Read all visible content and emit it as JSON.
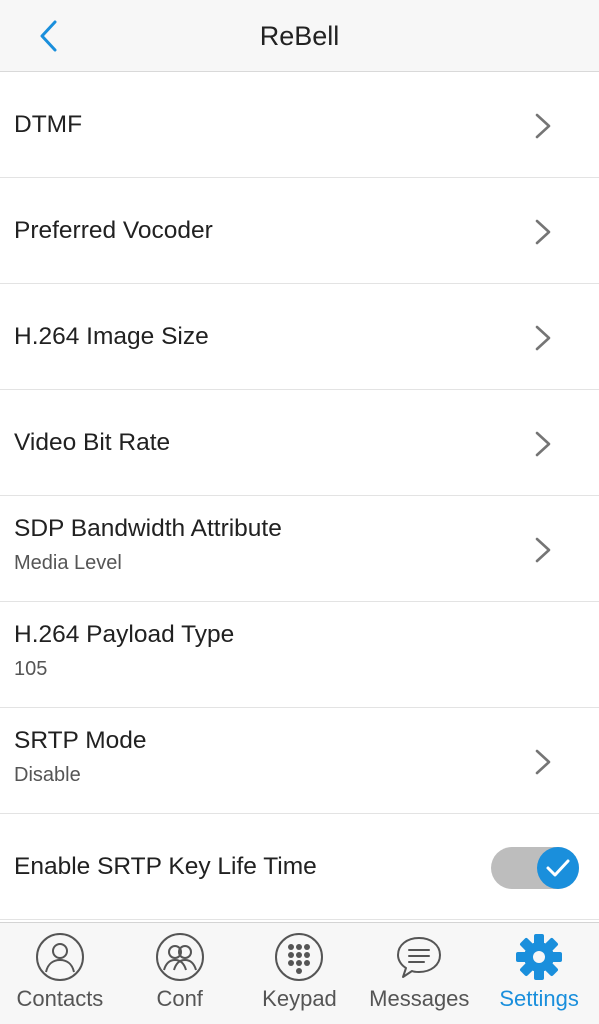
{
  "header": {
    "title": "ReBell",
    "back_icon": "chevron-left-icon"
  },
  "settings": [
    {
      "label": "DTMF",
      "value": "",
      "has_chevron": true
    },
    {
      "label": "Preferred Vocoder",
      "value": "",
      "has_chevron": true
    },
    {
      "label": "H.264 Image Size",
      "value": "",
      "has_chevron": true
    },
    {
      "label": "Video Bit Rate",
      "value": "",
      "has_chevron": true
    },
    {
      "label": "SDP Bandwidth Attribute",
      "value": "Media Level",
      "has_chevron": true
    },
    {
      "label": "H.264 Payload Type",
      "value": "105",
      "has_chevron": false
    },
    {
      "label": "SRTP Mode",
      "value": "Disable",
      "has_chevron": true
    },
    {
      "label": "Enable SRTP Key Life Time",
      "value": "",
      "toggle": true,
      "toggle_on": true
    }
  ],
  "tabs": [
    {
      "label": "Contacts",
      "icon": "person-icon",
      "active": false
    },
    {
      "label": "Conf",
      "icon": "group-icon",
      "active": false
    },
    {
      "label": "Keypad",
      "icon": "keypad-icon",
      "active": false
    },
    {
      "label": "Messages",
      "icon": "chat-bubble-icon",
      "active": false
    },
    {
      "label": "Settings",
      "icon": "gear-icon",
      "active": true
    }
  ],
  "colors": {
    "accent": "#1a8fdc",
    "inactive_icon": "#555555",
    "toggle_track": "#bdbdbd"
  }
}
